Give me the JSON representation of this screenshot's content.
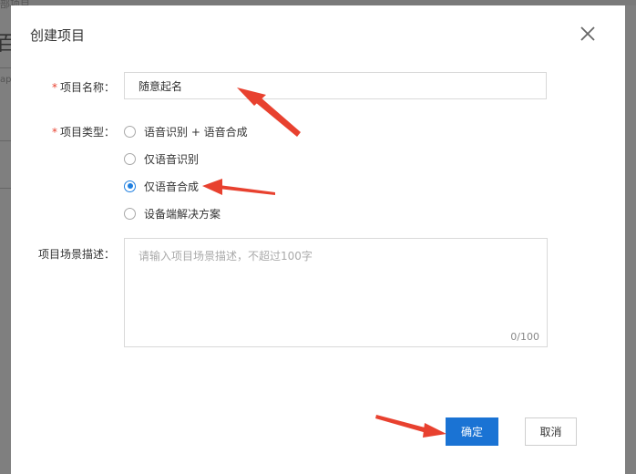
{
  "background": {
    "crumb": "部项目",
    "glyph": "百",
    "side_text": "ap"
  },
  "dialog": {
    "title": "创建项目",
    "close_icon": "close-icon",
    "required_mark": "*",
    "name_label": "项目名称：",
    "name_value": "随意起名",
    "type_label": "项目类型：",
    "type_options": [
      {
        "label": "语音识别 + 语音合成",
        "checked": false
      },
      {
        "label": "仅语音识别",
        "checked": false
      },
      {
        "label": "仅语音合成",
        "checked": true
      },
      {
        "label": "设备端解决方案",
        "checked": false
      }
    ],
    "desc_label": "项目场景描述：",
    "desc_placeholder": "请输入项目场景描述，不超过100字",
    "desc_value": "",
    "desc_counter": "0/100",
    "ok_label": "确定",
    "cancel_label": "取消"
  },
  "colors": {
    "primary": "#1a73d4",
    "required": "#e8412f",
    "annotation_arrow": "#e8412f"
  }
}
